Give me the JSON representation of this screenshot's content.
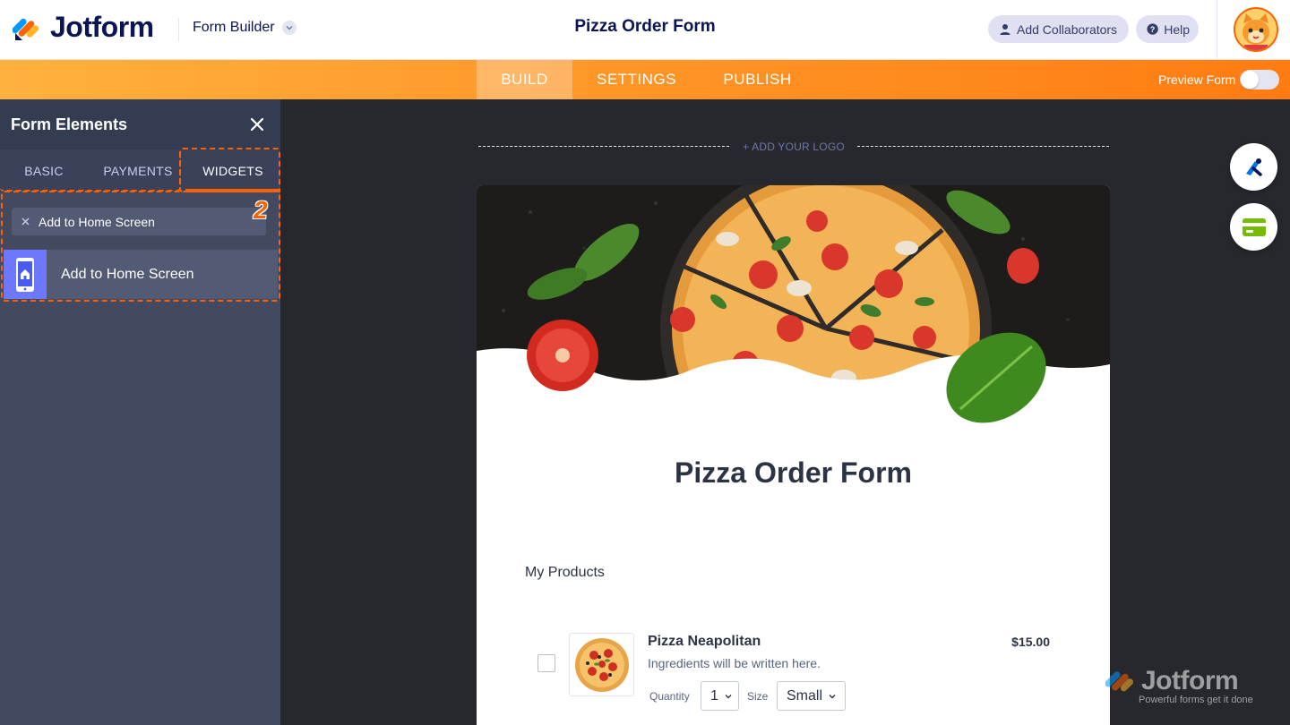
{
  "header": {
    "brand": "Jotform",
    "menu_label": "Form Builder",
    "form_title": "Pizza Order Form",
    "collaborators_label": "Add Collaborators",
    "help_label": "Help"
  },
  "nav": {
    "tabs": [
      {
        "label": "BUILD",
        "active": true
      },
      {
        "label": "SETTINGS",
        "active": false
      },
      {
        "label": "PUBLISH",
        "active": false
      }
    ],
    "preview_label": "Preview Form",
    "preview_enabled": false
  },
  "panel": {
    "title": "Form Elements",
    "tabs": [
      {
        "label": "BASIC"
      },
      {
        "label": "PAYMENTS"
      },
      {
        "label": "WIDGETS",
        "active": true
      }
    ],
    "search_value": "Add to Home Screen",
    "step_badge": "2",
    "results": [
      {
        "label": "Add to Home Screen",
        "icon": "phone-home-icon"
      }
    ]
  },
  "canvas": {
    "add_logo_label": "+ ADD YOUR LOGO",
    "form_heading": "Pizza Order Form",
    "section_label": "My Products",
    "product": {
      "name": "Pizza Neapolitan",
      "description": "Ingredients will be written here.",
      "price": "$15.00",
      "quantity_label": "Quantity",
      "quantity_value": "1",
      "size_label": "Size",
      "size_value": "Small"
    }
  },
  "watermark": {
    "brand": "Jotform",
    "tagline": "Powerful forms get it done"
  },
  "colors": {
    "accent": "#ff6100",
    "navy": "#0a1551",
    "panel": "#434a60",
    "canvas_bg": "#27282e"
  }
}
